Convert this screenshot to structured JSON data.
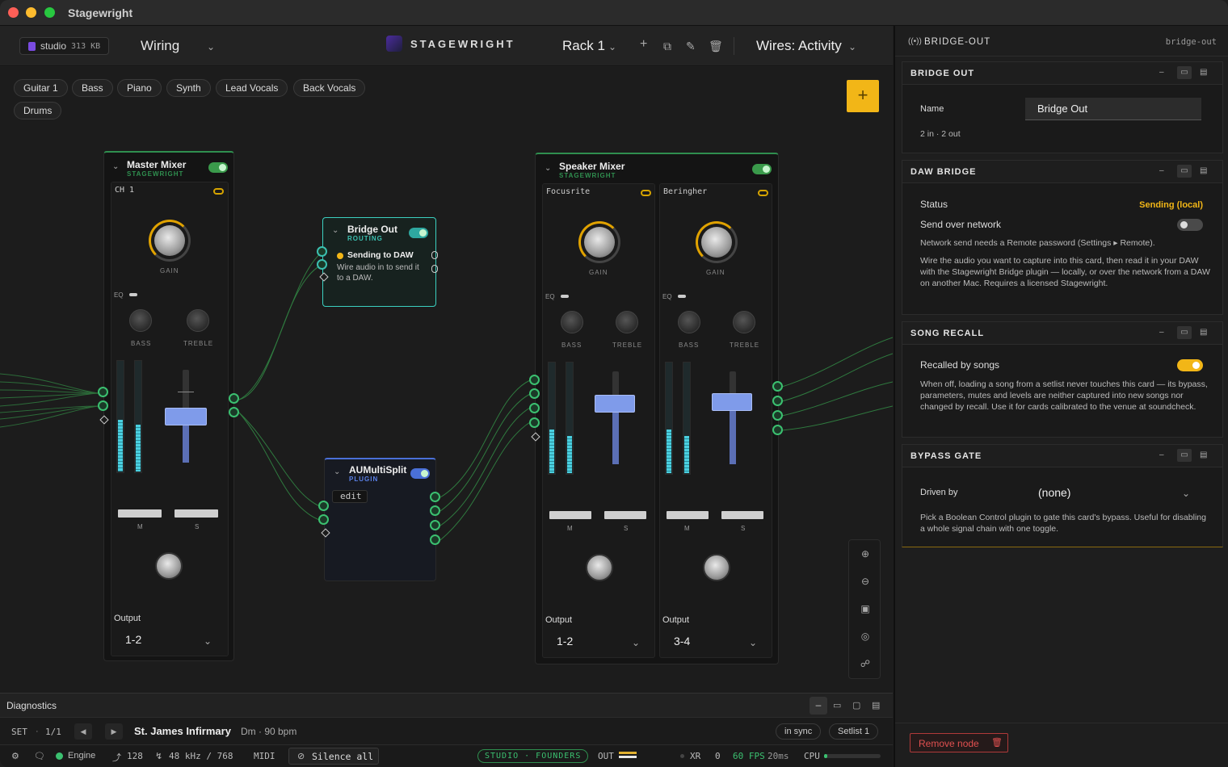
{
  "app_title": "Stagewright",
  "topbar": {
    "studio_label": "studio",
    "studio_size": "313 KB",
    "view": "Wiring",
    "brand": "STAGEWRIGHT",
    "rack": "Rack 1",
    "wires": "Wires: Activity"
  },
  "chips": [
    "Guitar 1",
    "Bass",
    "Piano",
    "Synth",
    "Lead Vocals",
    "Back Vocals",
    "Drums"
  ],
  "add_label": "+",
  "master": {
    "title": "Master Mixer",
    "sub": "STAGEWRIGHT",
    "channel": "CH 1",
    "gain": "GAIN",
    "eq": "EQ",
    "bass": "BASS",
    "treble": "TREBLE",
    "m": "M",
    "s": "S",
    "output_label": "Output",
    "output_value": "1-2"
  },
  "bridge": {
    "title": "Bridge Out",
    "sub": "ROUTING",
    "status": "Sending to DAW",
    "desc": "Wire audio in to send it to a DAW."
  },
  "au": {
    "title": "AUMultiSplit",
    "sub": "PLUGIN",
    "edit": "edit"
  },
  "speaker": {
    "title": "Speaker Mixer",
    "sub": "STAGEWRIGHT",
    "gain": "GAIN",
    "eq": "EQ",
    "bass": "BASS",
    "treble": "TREBLE",
    "m": "M",
    "s": "S",
    "output_label": "Output",
    "ch1": {
      "name": "Focusrite",
      "output": "1-2"
    },
    "ch2": {
      "name": "Beringher",
      "output": "3-4"
    }
  },
  "diagnostics": "Diagnostics",
  "setbar": {
    "set": "SET",
    "set_pos": "1/1",
    "song": "St. James Infirmary",
    "meta": "Dm · 90 bpm",
    "sync": "in sync",
    "setlist": "Setlist 1"
  },
  "status": {
    "engine": "Engine",
    "buffer": "128",
    "rate": "48 kHz / 768",
    "midi": "MIDI",
    "silence": "Silence all",
    "edition": "STUDIO · FOUNDERS",
    "out": "OUT",
    "xr": "XR",
    "xr_val": "0",
    "fps": "60 FPS",
    "ms": "20ms",
    "cpu": "CPU"
  },
  "panel": {
    "header": "BRIDGE-OUT",
    "id": "bridge-out",
    "sections": {
      "bridge_out": {
        "title": "BRIDGE OUT",
        "name_label": "Name",
        "name_value": "Bridge Out",
        "io": "2 in · 2 out"
      },
      "daw": {
        "title": "DAW BRIDGE",
        "status_label": "Status",
        "status_value": "Sending (local)",
        "network_label": "Send over network",
        "network_note": "Network send needs a Remote password (Settings ▸ Remote).",
        "desc": "Wire the audio you want to capture into this card, then read it in your DAW with the Stagewright Bridge plugin — locally, or over the network from a DAW on another Mac. Requires a licensed Stagewright."
      },
      "song": {
        "title": "SONG RECALL",
        "label": "Recalled by songs",
        "desc": "When off, loading a song from a setlist never touches this card — its bypass, parameters, mutes and levels are neither captured into new songs nor changed by recall. Use it for cards calibrated to the venue at soundcheck."
      },
      "bypass": {
        "title": "BYPASS GATE",
        "label": "Driven by",
        "value": "(none)",
        "desc": "Pick a Boolean Control plugin to gate this card's bypass. Useful for disabling a whole signal chain with one toggle."
      }
    },
    "remove": "Remove node"
  },
  "colors": {
    "accent": "#f2b617",
    "green": "#3bc070",
    "fader": "#7f9bea",
    "meter": "#4ad0e0",
    "sending": "#f2b617",
    "remove": "#e05050"
  }
}
